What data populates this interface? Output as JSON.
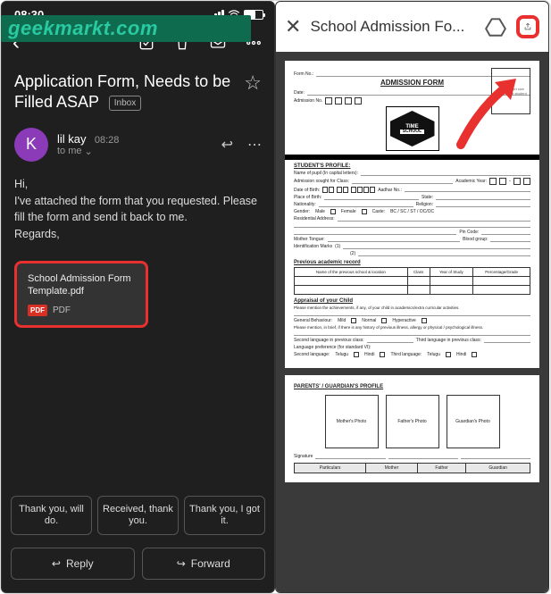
{
  "watermark": "geekmarkt.com",
  "status": {
    "time": "08:30"
  },
  "email": {
    "subject": "Application Form, Needs to be Filled ASAP",
    "inbox_label": "Inbox",
    "sender": {
      "initial": "K",
      "name": "lil kay",
      "time": "08:28",
      "to": "to me"
    },
    "body": {
      "greeting": "Hi,",
      "line1": "I've attached the form that you requested. Please fill the form and send it back to me.",
      "signoff": "Regards,"
    },
    "attachment": {
      "name": "School Admission Form Template.pdf",
      "type": "PDF",
      "badge": "PDF"
    },
    "quick_replies": [
      "Thank you, will do.",
      "Received, thank you.",
      "Thank you, I got it."
    ],
    "actions": {
      "reply": "Reply",
      "forward": "Forward"
    }
  },
  "pdf": {
    "header_title": "School Admission Fo...",
    "form": {
      "title": "ADMISSION FORM",
      "logo_line1": "TIME",
      "logo_line2": "SCHOOL",
      "top_fields": {
        "form_no": "Form No.:",
        "date": "Date:",
        "admission_no": "Admission No."
      },
      "photo_text": "Fix passport size photo of the student",
      "section_student": "STUDENT'S PROFILE:",
      "labels": {
        "name": "Name of pupil (In capital letters):",
        "class": "Admission sought for Class:",
        "year": "Academic Year:",
        "dob": "Date of Birth:",
        "aadhar": "Aadhar No.:",
        "pob": "Place of Birth:",
        "state": "State:",
        "nationality": "Nationality:",
        "religion": "Religion:",
        "gender": "Gender:",
        "male": "Male",
        "female": "Female",
        "caste": "Caste:",
        "caste_opts": "BC / SC / ST / OC/OC",
        "address": "Residential Address:",
        "pin": "Pin Code:",
        "tongue": "Mother Tongue:",
        "blood": "Blood group:",
        "marks": "Identification Marks",
        "m1": "(1)",
        "m2": "(2)"
      },
      "prev_record": "Previous academic record",
      "prev_cols": [
        "Name of the previous school & location",
        "Class",
        "Year of Study",
        "Percentage/Grade"
      ],
      "appraisal": "Appraisal of your Child",
      "appraisal_text": "Please mention the achievements, if any, of your child in academics/extra curricular activities.",
      "behaviour": "General Behaviour:",
      "behav_opts": [
        "Mild",
        "Normal",
        "Hyperactive"
      ],
      "behav_note": "Please mention, in brief, if there is any history of previous illness, allergy or physical / psychological illness.",
      "lang_prev": "Second language in previous class:",
      "lang_pres": "Third language in previous class:",
      "lang_pref": "Language preference (for standard VI):",
      "lang2": "Second language:",
      "lang3": "Third language:",
      "lang_opts": [
        "Telugu",
        "Hindi"
      ],
      "parents_title": "PARENTS' / GUARDIAN'S PROFILE",
      "parent_boxes": [
        "Mother's Photo",
        "Father's Photo",
        "Guardian's Photo"
      ],
      "signature": "Signature",
      "guardian_cols": [
        "Particulars",
        "Mother",
        "Father",
        "Guardian"
      ]
    }
  }
}
